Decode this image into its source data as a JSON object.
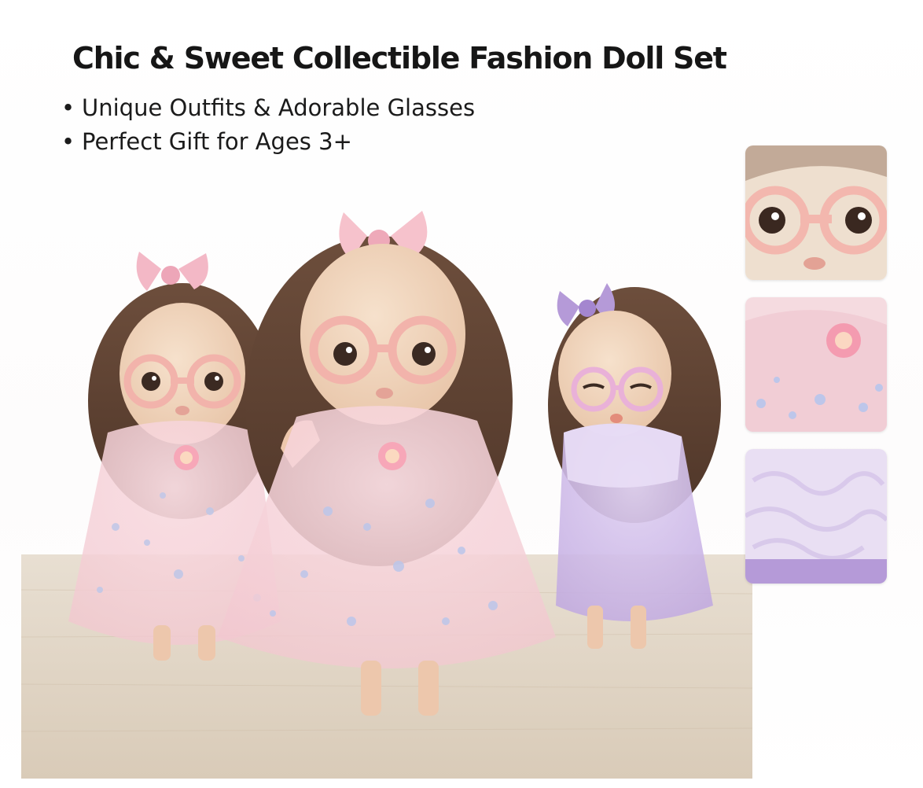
{
  "header": {
    "title": "Chic & Sweet Collectible Fashion Doll Set",
    "bullets": [
      "Unique Outfits & Adorable Glasses",
      "Perfect Gift for Ages 3+"
    ]
  },
  "product_photo": {
    "icon": "three-dolls-photo",
    "dolls": [
      {
        "dress_color": "#f6cfd6",
        "bow_color": "#f3b8c6",
        "glasses_color": "#f2b3ab"
      },
      {
        "dress_color": "#f6cfd6",
        "bow_color": "#f3b8c6",
        "glasses_color": "#f2b3ab"
      },
      {
        "dress_color": "#c9b4e6",
        "bow_color": "#b59ad8",
        "glasses_color": "#e9b1d8"
      }
    ],
    "table_color": "#e3d8c9"
  },
  "detail_thumbnails": [
    {
      "icon": "face-closeup-thumbnail"
    },
    {
      "icon": "pink-dress-detail-thumbnail"
    },
    {
      "icon": "purple-dress-detail-thumbnail"
    }
  ]
}
